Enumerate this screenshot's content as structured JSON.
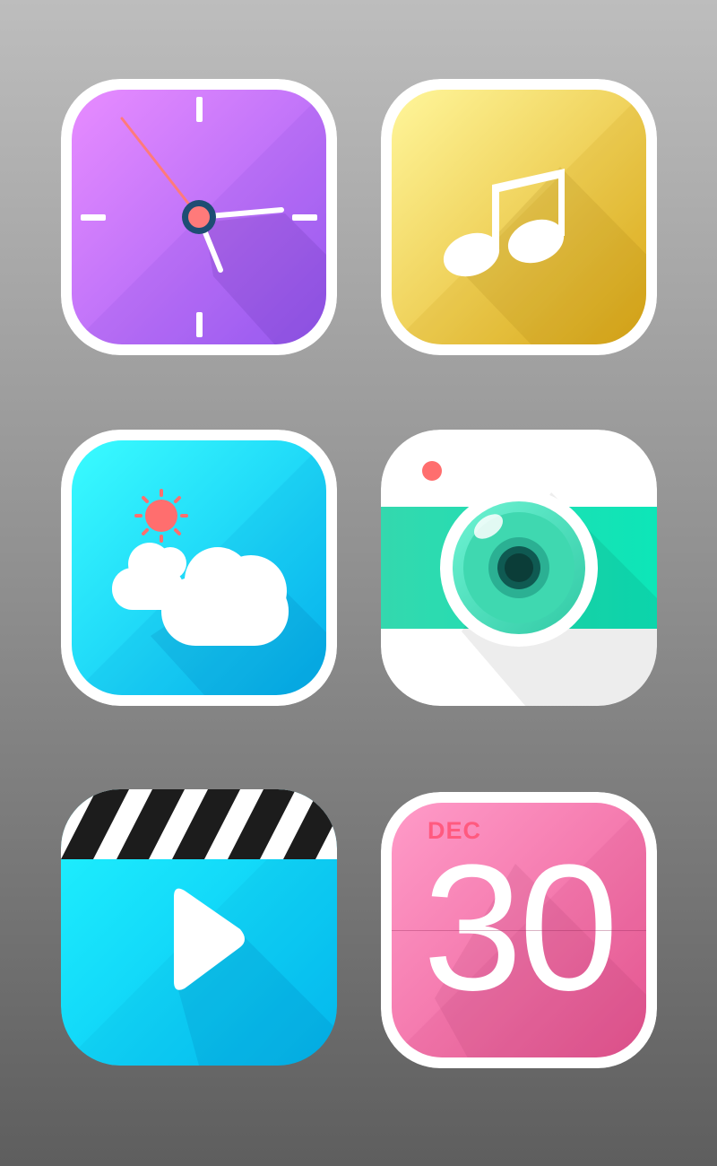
{
  "colors": {
    "clock_top": "#e58bff",
    "clock_bottom": "#9d5cf2",
    "clock_second_hand": "#ff7a7a",
    "music_top": "#fff59a",
    "music_bottom": "#e3b21d",
    "weather_top": "#35fbff",
    "weather_bottom": "#06b8f2",
    "sun": "#ff6e6e",
    "camera_band_left": "#36e3b7",
    "camera_band_right": "#0af0c0",
    "camera_flash": "#ff6e6e",
    "video_top": "#1ff2ff",
    "video_bottom": "#05c0f2",
    "calendar_top": "#ff96c6",
    "calendar_bottom": "#ec5d97",
    "calendar_month_text": "#ff5a7f"
  },
  "apps": [
    {
      "id": "clock",
      "icon": "clock-icon"
    },
    {
      "id": "music",
      "icon": "music-note-icon"
    },
    {
      "id": "weather",
      "icon": "sun-cloud-icon"
    },
    {
      "id": "camera",
      "icon": "camera-icon"
    },
    {
      "id": "video",
      "icon": "clapperboard-play-icon"
    },
    {
      "id": "calendar",
      "icon": "calendar-icon",
      "month": "DEC",
      "day": "30"
    }
  ]
}
